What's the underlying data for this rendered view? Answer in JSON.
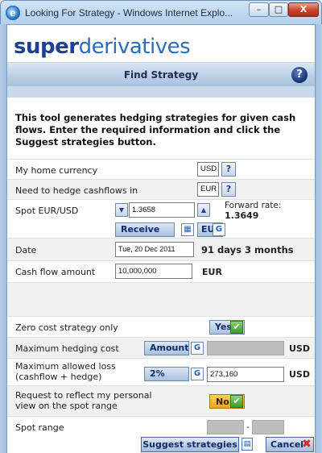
{
  "window": {
    "title": "Looking For Strategy - Windows Internet Explo...",
    "minimize": "–",
    "maximize": "□",
    "close": "X"
  },
  "logo": {
    "bold": "super",
    "light": "derivatives"
  },
  "header": {
    "title": "Find Strategy",
    "help": "?"
  },
  "intro": "This tool generates hedging strategies for given cash flows. Enter the required information and click the Suggest strategies button.",
  "form": {
    "home_currency": {
      "label": "My home currency",
      "value": "USD",
      "help": "?"
    },
    "hedge_currency": {
      "label": "Need to hedge cashflows in",
      "value": "EUR",
      "help": "?"
    },
    "spot": {
      "label": "Spot EUR/USD",
      "value": "1.3658",
      "forward_label": "Forward rate:",
      "forward_value": "1.3649",
      "direction": "Receive",
      "currency": "EUR"
    },
    "date": {
      "label": "Date",
      "value": "Tue, 20 Dec 2011",
      "days": "91",
      "days_unit": "days",
      "period": "3 months"
    },
    "cash_flow": {
      "label": "Cash flow amount",
      "value": "10,000,000",
      "currency": "EUR"
    },
    "zero_cost": {
      "label": "Zero cost strategy only",
      "value": "Yes"
    },
    "max_hedging_cost": {
      "label": "Maximum hedging cost",
      "mode": "Amount",
      "currency": "USD"
    },
    "max_loss": {
      "label_line1": "Maximum allowed loss",
      "label_line2": "(cashflow + hedge)",
      "mode": "2%",
      "value": "273,160",
      "currency": "USD"
    },
    "personal_view": {
      "label_line1": "Request to reflect my personal",
      "label_line2": "view on the spot range",
      "value": "No"
    },
    "spot_range": {
      "label": "Spot range",
      "separator": "-"
    }
  },
  "actions": {
    "suggest": "Suggest strategies",
    "cancel": "Cancel"
  },
  "icons": {
    "refresh": "G",
    "check": "✔",
    "arrow_down": "▼",
    "arrow_up": "▲",
    "calc": "▦",
    "doc": "▤",
    "x": "✖"
  },
  "colors": {
    "brand_dark": "#1f3f93",
    "brand_light": "#2c6db8",
    "yes_green": "#3e9a2b",
    "no_orange": "#f0a41c",
    "cancel_red": "#d32a1a"
  }
}
